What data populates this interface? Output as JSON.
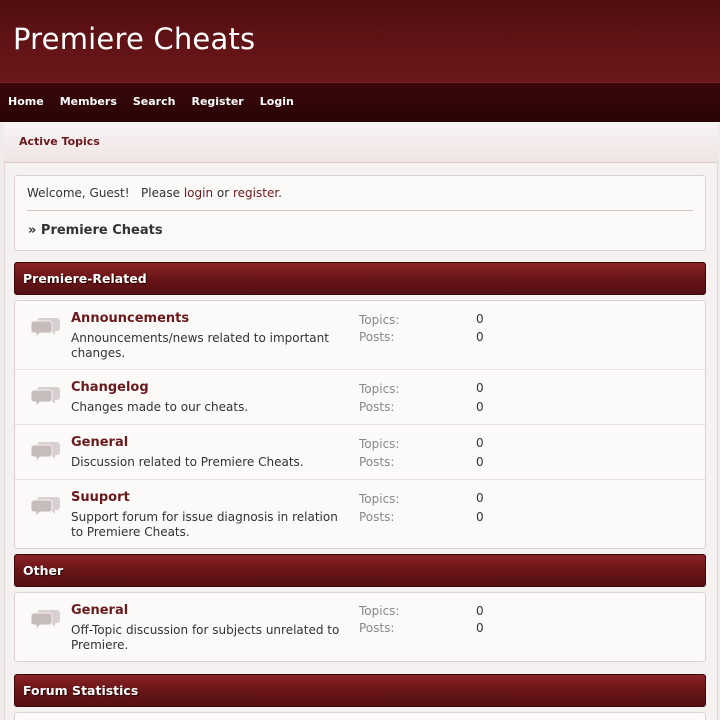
{
  "header": {
    "title": "Premiere Cheats"
  },
  "nav": {
    "items": [
      "Home",
      "Members",
      "Search",
      "Register",
      "Login"
    ]
  },
  "subnav": {
    "active_topics": "Active Topics"
  },
  "welcome": {
    "greeting": "Welcome, Guest!",
    "please": "Please",
    "login": "login",
    "or": "or",
    "register": "register",
    "period": ".",
    "breadcrumb": "» Premiere Cheats"
  },
  "stat_labels": {
    "topics": "Topics:",
    "posts": "Posts:"
  },
  "categories": [
    {
      "name": "Premiere-Related",
      "forums": [
        {
          "name": "Announcements",
          "description": "Announcements/news related to important changes.",
          "topics": "0",
          "posts": "0"
        },
        {
          "name": "Changelog",
          "description": "Changes made to our cheats.",
          "topics": "0",
          "posts": "0"
        },
        {
          "name": "General",
          "description": "Discussion related to Premiere Cheats.",
          "topics": "0",
          "posts": "0"
        },
        {
          "name": "Suuport",
          "description": "Support forum for issue diagnosis in relation to Premiere Cheats.",
          "topics": "0",
          "posts": "0"
        }
      ]
    },
    {
      "name": "Other",
      "forums": [
        {
          "name": "General",
          "description": "Off-Topic discussion for subjects unrelated to Premiere.",
          "topics": "0",
          "posts": "0"
        }
      ]
    },
    {
      "name": "Forum Statistics",
      "forums": []
    }
  ],
  "icons": {
    "forum": "speech-bubbles-icon"
  },
  "colors": {
    "brand": "#621316",
    "link": "#6b1a1c"
  }
}
